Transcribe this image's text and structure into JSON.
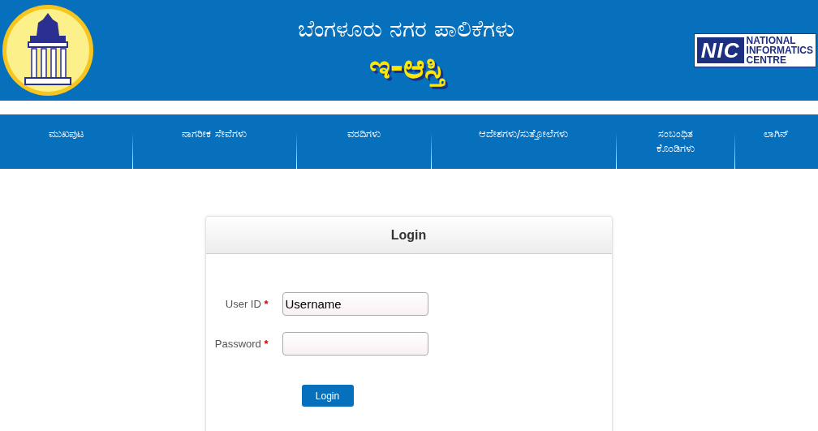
{
  "header": {
    "title": "ಬೆಂಗಳೂರು ನಗರ ಪಾಲಿಕೆಗಳು",
    "subtitle": "ಇ-ಆಸ್ತಿ",
    "nic_logo": {
      "mark": "NIC",
      "lines": [
        "NATIONAL",
        "INFORMATICS",
        "CENTRE"
      ]
    }
  },
  "nav": [
    {
      "label": "ಮುಖಪುಟ"
    },
    {
      "label": "ನಾಗರೀಕ ಸೇವೆಗಳು"
    },
    {
      "label": "ವರದಿಗಳು"
    },
    {
      "label": "ಆದೇಶಗಳು/ಸುತ್ತೋಲೆಗಳು"
    },
    {
      "label": "ಸಂಬಂಧಿತ ಕೊಂಡಿಗಳು"
    },
    {
      "label": "ಲಾಗಿನ್"
    }
  ],
  "login": {
    "title": "Login",
    "fields": [
      {
        "label": "User ID",
        "required": "*",
        "kind": "text",
        "value": "Username"
      },
      {
        "label": "Password",
        "required": "*",
        "kind": "password"
      }
    ],
    "button": "Login"
  }
}
